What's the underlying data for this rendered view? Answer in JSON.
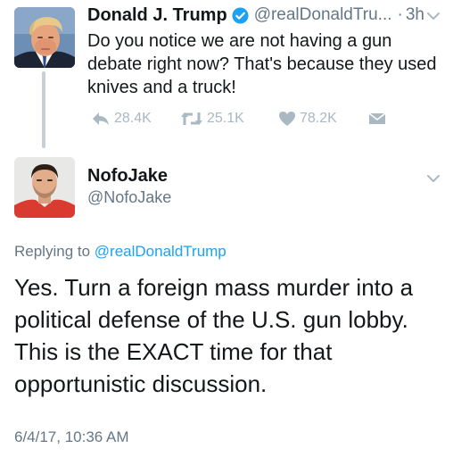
{
  "parent_tweet": {
    "display_name": "Donald J. Trump",
    "handle": "@realDonaldTru...",
    "time": "3h",
    "text": "Do you notice we are not having a gun debate right now? That's because they used knives and a truck!",
    "actions": {
      "reply_icon": "reply-icon",
      "reply_count": "28.4K",
      "retweet_icon": "retweet-icon",
      "retweet_count": "25.1K",
      "like_icon": "heart-icon",
      "like_count": "78.2K",
      "dm_icon": "envelope-icon"
    }
  },
  "reply_tweet": {
    "display_name": "NofoJake",
    "handle": "@NofoJake",
    "replying_to_label": "Replying to",
    "replying_to_handle": "@realDonaldTrump",
    "text": "Yes. Turn a foreign mass murder into a political defense of the U.S. gun lobby. This is the EXACT time for that opportunistic discussion.",
    "timestamp": "6/4/17, 10:36 AM"
  },
  "colors": {
    "verified_blue": "#1da1f2",
    "link_blue": "#1da1f2",
    "secondary_text": "#657786",
    "action_grey": "#aab8c2",
    "thread_line": "#c7d0d8"
  }
}
